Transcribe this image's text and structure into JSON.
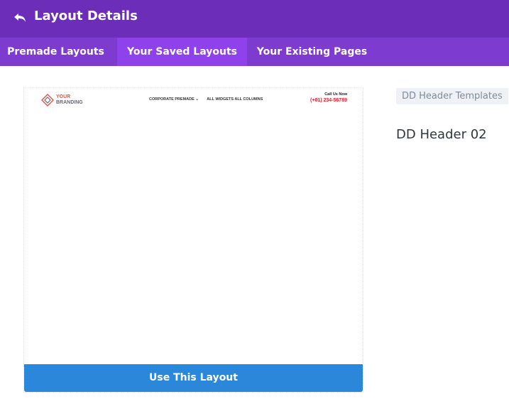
{
  "header": {
    "title": "Layout Details",
    "back_icon": "undo-arrow-icon"
  },
  "tabs": [
    {
      "label": "Premade Layouts",
      "active": false
    },
    {
      "label": "Your Saved Layouts",
      "active": true
    },
    {
      "label": "Your Existing Pages",
      "active": false
    }
  ],
  "preview": {
    "brand_line1": "YOUR",
    "brand_line2": "BRANDING",
    "nav_item_1": "CORPORATE PREMADE ⌄",
    "nav_item_2": "ALL WIDGETS ALL COLUMNS",
    "call_label": "Call Us Now",
    "call_phone": "(+01) 234-56789"
  },
  "use_button_label": "Use This Layout",
  "category_tag": "DD Header Templates",
  "layout_name": "DD Header 02",
  "colors": {
    "title_bar": "#6c2eb9",
    "tab_bar": "#7e3bd0",
    "active_tab": "#8f42ec",
    "button": "#2b87da",
    "brand_red": "#e2574c"
  }
}
